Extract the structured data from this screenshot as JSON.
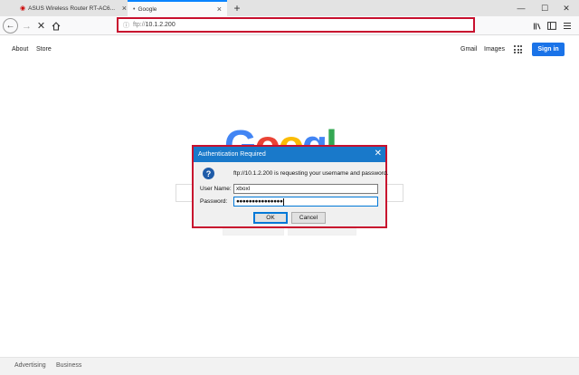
{
  "browser": {
    "tabs": [
      {
        "title": "ASUS Wireless Router RT-AC6...",
        "icon": "router-icon",
        "active": false
      },
      {
        "title": "Google",
        "icon": "loading-icon",
        "active": true
      }
    ],
    "new_tab_label": "+",
    "window_controls": {
      "minimize": "—",
      "maximize": "☐",
      "close": "✕"
    },
    "url_protocol": "ftp://",
    "url_host": "10.1.2.200",
    "toolbar_icons": [
      "library-icon",
      "sidebar-icon",
      "menu-icon"
    ]
  },
  "google": {
    "top_left_links": [
      "About",
      "Store"
    ],
    "top_right_links": [
      "Gmail",
      "Images"
    ],
    "sign_in_label": "Sign in",
    "logo_letters": [
      {
        "ch": "G",
        "color": "#4285f4"
      },
      {
        "ch": "o",
        "color": "#ea4335"
      },
      {
        "ch": "o",
        "color": "#fbbc05"
      },
      {
        "ch": "g",
        "color": "#4285f4"
      },
      {
        "ch": "l",
        "color": "#34a853"
      },
      {
        "ch": "e",
        "color": "#ea4335"
      }
    ],
    "footer_links": [
      "Advertising",
      "Business"
    ]
  },
  "dialog": {
    "title": "Authentication Required",
    "message": "ftp://10.1.2.200 is requesting your username and password.",
    "username_label": "User Name:",
    "username_value": "xboxl",
    "password_label": "Password:",
    "password_value": "●●●●●●●●●●●●●●●",
    "ok_label": "OK",
    "cancel_label": "Cancel",
    "accent_color": "#1979ca",
    "highlight_color": "#c8102e"
  }
}
